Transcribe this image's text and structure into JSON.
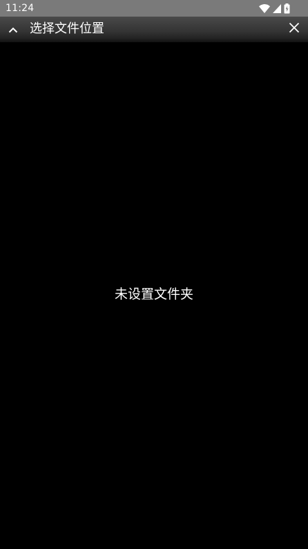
{
  "status_bar": {
    "time": "11:24",
    "icons": [
      "wifi-icon",
      "cell-signal-icon",
      "battery-charging-icon"
    ]
  },
  "toolbar": {
    "title": "选择文件位置",
    "collapse_icon": "chevron-up-icon",
    "close_icon": "close-icon"
  },
  "content": {
    "empty_message": "未设置文件夹"
  },
  "colors": {
    "status_bar_bg": "#7a7a7a",
    "toolbar_bg": "#3e3e3e",
    "content_bg": "#000000",
    "text": "#ffffff"
  }
}
